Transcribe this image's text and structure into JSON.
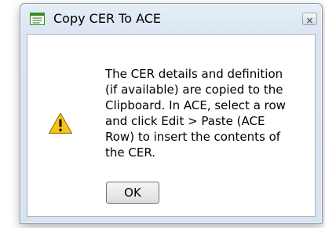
{
  "dialog": {
    "title": "Copy CER To ACE",
    "message_lines": [
      "The CER details and definition",
      "(if available) are copied to the",
      "Clipboard. In ACE, select a row",
      "and click Edit > Paste (ACE",
      "Row) to insert the contents of",
      "the CER."
    ],
    "ok_label": "OK",
    "icons": {
      "app": "document-icon",
      "close": "close-icon",
      "message": "warning-icon"
    }
  },
  "colors": {
    "warning_fill": "#f5c518",
    "app_icon_green": "#3c8a2e"
  }
}
